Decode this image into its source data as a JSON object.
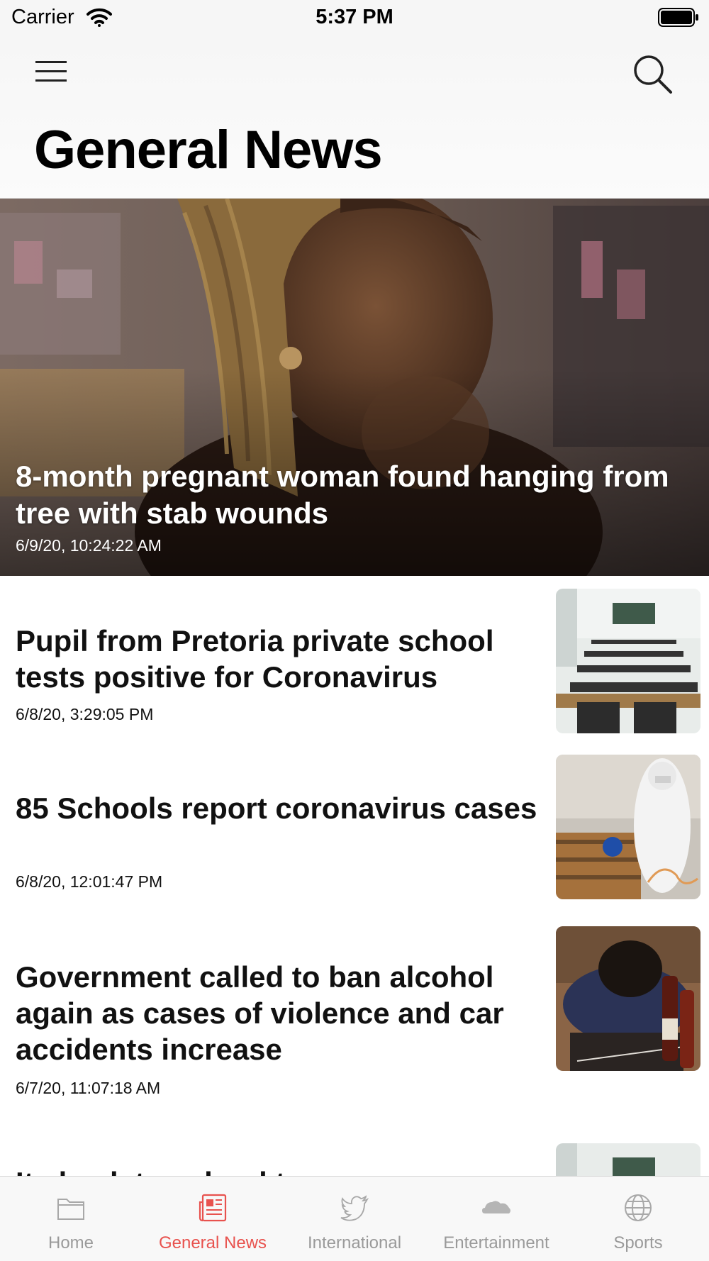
{
  "status_bar": {
    "carrier": "Carrier",
    "time": "5:37 PM"
  },
  "header": {
    "title": "General News",
    "menu_icon": "hamburger-menu-icon",
    "search_icon": "search-icon"
  },
  "featured": {
    "title": "8-month pregnant woman found hanging from tree with stab wounds",
    "date": "6/9/20, 10:24:22 AM"
  },
  "articles": [
    {
      "title": "Pupil from Pretoria private school tests positive for Coronavirus",
      "date": "6/8/20, 3:29:05 PM"
    },
    {
      "title": "85 Schools report coronavirus cases",
      "date": "6/8/20, 12:01:47 PM"
    },
    {
      "title": "Government called to ban alcohol again as cases of violence and car accidents increase",
      "date": "6/7/20, 11:07:18 AM"
    },
    {
      "title": "Its back to school tomorrow"
    }
  ],
  "tabs": [
    {
      "label": "Home",
      "icon": "folder-icon"
    },
    {
      "label": "General News",
      "icon": "newspaper-icon"
    },
    {
      "label": "International",
      "icon": "twitter-bird-icon"
    },
    {
      "label": "Entertainment",
      "icon": "cloud-icon"
    },
    {
      "label": "Sports",
      "icon": "globe-icon"
    }
  ],
  "colors": {
    "active_tab": "#e8524e",
    "inactive_tab": "#9a9a9a"
  }
}
